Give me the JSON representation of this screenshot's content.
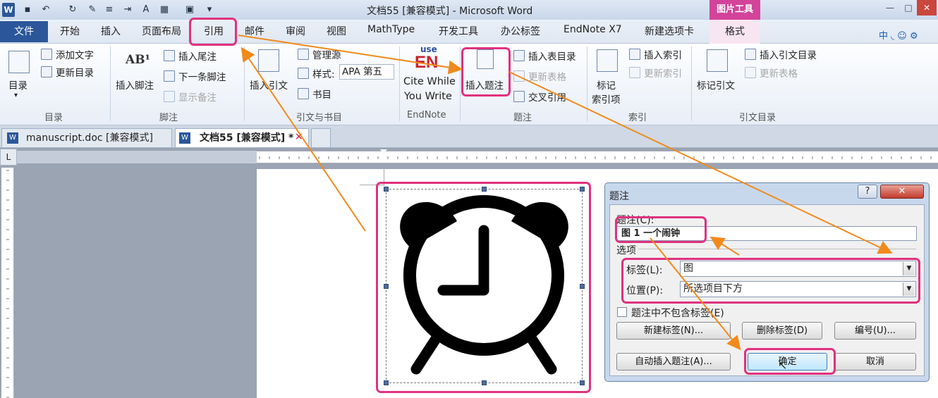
{
  "window": {
    "title": "文档55 [兼容模式] - Microsoft Word",
    "picture_tools": "图片工具",
    "min": "—",
    "max": "□",
    "close": "✕"
  },
  "quick_access": {
    "save": "▪",
    "undo": "↶",
    "redo": "↻",
    "font": "A"
  },
  "tabs": [
    "开始",
    "插入",
    "页面布局",
    "引用",
    "邮件",
    "审阅",
    "视图",
    "MathType",
    "开发工具",
    "办公标签",
    "EndNote X7",
    "新建选项卡"
  ],
  "file_tab": "文件",
  "format_tab": "格式",
  "ime": "中 ◟ ☺ ⚙",
  "ribbon": {
    "toc": {
      "label": "目录",
      "add_text": "添加文字",
      "update_toc": "更新目录",
      "group": "目录"
    },
    "footnote": {
      "insert_footnote": "插入脚注",
      "insert_endnote": "插入尾注",
      "next_footnote": "下一条脚注",
      "show_notes": "显示备注",
      "group": "脚注",
      "icon_text": "AB¹"
    },
    "citation": {
      "insert_citation": "插入引文",
      "manage_sources": "管理源",
      "style_label": "样式:",
      "style_value": "APA 第五",
      "bibliography": "书目",
      "group": "引文与书目"
    },
    "endnote": {
      "use": "use",
      "en": "EN",
      "line1": "Cite While",
      "line2": "You Write",
      "group": "EndNote"
    },
    "caption": {
      "insert_caption": "插入题注",
      "insert_tof": "插入表目录",
      "update_table": "更新表格",
      "cross_ref": "交叉引用",
      "group": "题注"
    },
    "index": {
      "mark_entry_1": "标记",
      "mark_entry_2": "索引项",
      "insert_index": "插入索引",
      "update_index": "更新索引",
      "group": "索引"
    },
    "toa": {
      "mark_citation": "标记引文",
      "insert_toa": "插入引文目录",
      "update_table": "更新表格",
      "group": "引文目录"
    }
  },
  "doc_tabs": [
    {
      "label": "manuscript.doc [兼容模式]"
    },
    {
      "label": "文档55 [兼容模式] *",
      "close": "×"
    }
  ],
  "ruler_corner": "L",
  "dialog": {
    "title": "题注",
    "help": "?",
    "close": "✕",
    "caption_label": "题注(C):",
    "caption_value": "图 1 一个闹钟",
    "options_label": "选项",
    "tag_label": "标签(L):",
    "tag_value": "图",
    "position_label": "位置(P):",
    "position_value": "所选项目下方",
    "exclude_label": "题注中不包含标签(E)",
    "new_label_btn": "新建标签(N)...",
    "delete_label_btn": "删除标签(D)",
    "numbering_btn": "编号(U)...",
    "auto_caption_btn": "自动插入题注(A)...",
    "ok_btn": "确定",
    "cancel_btn": "取消"
  },
  "colors": {
    "accent": "#2b579a",
    "highlight": "#e0317f",
    "arrow": "#f08a1c",
    "picture_tools": "#d3439a"
  }
}
